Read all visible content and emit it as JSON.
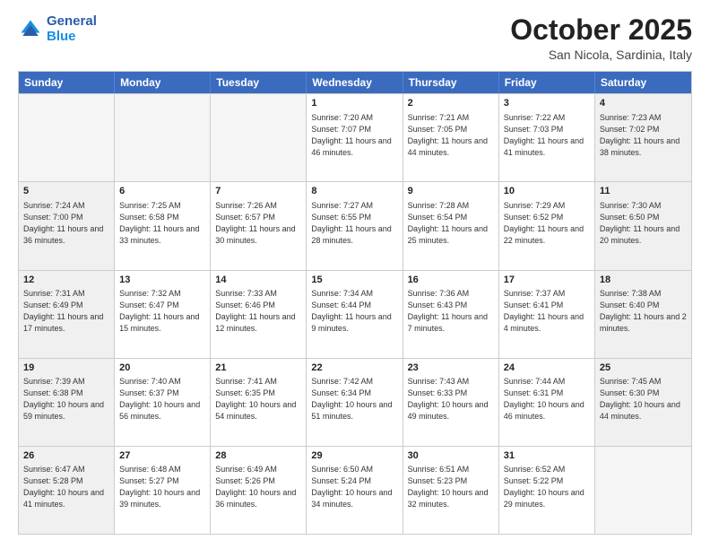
{
  "header": {
    "logo_line1": "General",
    "logo_line2": "Blue",
    "month_title": "October 2025",
    "location": "San Nicola, Sardinia, Italy"
  },
  "weekdays": [
    "Sunday",
    "Monday",
    "Tuesday",
    "Wednesday",
    "Thursday",
    "Friday",
    "Saturday"
  ],
  "rows": [
    [
      {
        "day": "",
        "info": "",
        "empty": true
      },
      {
        "day": "",
        "info": "",
        "empty": true
      },
      {
        "day": "",
        "info": "",
        "empty": true
      },
      {
        "day": "1",
        "info": "Sunrise: 7:20 AM\nSunset: 7:07 PM\nDaylight: 11 hours\nand 46 minutes.",
        "empty": false
      },
      {
        "day": "2",
        "info": "Sunrise: 7:21 AM\nSunset: 7:05 PM\nDaylight: 11 hours\nand 44 minutes.",
        "empty": false
      },
      {
        "day": "3",
        "info": "Sunrise: 7:22 AM\nSunset: 7:03 PM\nDaylight: 11 hours\nand 41 minutes.",
        "empty": false
      },
      {
        "day": "4",
        "info": "Sunrise: 7:23 AM\nSunset: 7:02 PM\nDaylight: 11 hours\nand 38 minutes.",
        "empty": false,
        "shaded": true
      }
    ],
    [
      {
        "day": "5",
        "info": "Sunrise: 7:24 AM\nSunset: 7:00 PM\nDaylight: 11 hours\nand 36 minutes.",
        "empty": false,
        "shaded": true
      },
      {
        "day": "6",
        "info": "Sunrise: 7:25 AM\nSunset: 6:58 PM\nDaylight: 11 hours\nand 33 minutes.",
        "empty": false
      },
      {
        "day": "7",
        "info": "Sunrise: 7:26 AM\nSunset: 6:57 PM\nDaylight: 11 hours\nand 30 minutes.",
        "empty": false
      },
      {
        "day": "8",
        "info": "Sunrise: 7:27 AM\nSunset: 6:55 PM\nDaylight: 11 hours\nand 28 minutes.",
        "empty": false
      },
      {
        "day": "9",
        "info": "Sunrise: 7:28 AM\nSunset: 6:54 PM\nDaylight: 11 hours\nand 25 minutes.",
        "empty": false
      },
      {
        "day": "10",
        "info": "Sunrise: 7:29 AM\nSunset: 6:52 PM\nDaylight: 11 hours\nand 22 minutes.",
        "empty": false
      },
      {
        "day": "11",
        "info": "Sunrise: 7:30 AM\nSunset: 6:50 PM\nDaylight: 11 hours\nand 20 minutes.",
        "empty": false,
        "shaded": true
      }
    ],
    [
      {
        "day": "12",
        "info": "Sunrise: 7:31 AM\nSunset: 6:49 PM\nDaylight: 11 hours\nand 17 minutes.",
        "empty": false,
        "shaded": true
      },
      {
        "day": "13",
        "info": "Sunrise: 7:32 AM\nSunset: 6:47 PM\nDaylight: 11 hours\nand 15 minutes.",
        "empty": false
      },
      {
        "day": "14",
        "info": "Sunrise: 7:33 AM\nSunset: 6:46 PM\nDaylight: 11 hours\nand 12 minutes.",
        "empty": false
      },
      {
        "day": "15",
        "info": "Sunrise: 7:34 AM\nSunset: 6:44 PM\nDaylight: 11 hours\nand 9 minutes.",
        "empty": false
      },
      {
        "day": "16",
        "info": "Sunrise: 7:36 AM\nSunset: 6:43 PM\nDaylight: 11 hours\nand 7 minutes.",
        "empty": false
      },
      {
        "day": "17",
        "info": "Sunrise: 7:37 AM\nSunset: 6:41 PM\nDaylight: 11 hours\nand 4 minutes.",
        "empty": false
      },
      {
        "day": "18",
        "info": "Sunrise: 7:38 AM\nSunset: 6:40 PM\nDaylight: 11 hours\nand 2 minutes.",
        "empty": false,
        "shaded": true
      }
    ],
    [
      {
        "day": "19",
        "info": "Sunrise: 7:39 AM\nSunset: 6:38 PM\nDaylight: 10 hours\nand 59 minutes.",
        "empty": false,
        "shaded": true
      },
      {
        "day": "20",
        "info": "Sunrise: 7:40 AM\nSunset: 6:37 PM\nDaylight: 10 hours\nand 56 minutes.",
        "empty": false
      },
      {
        "day": "21",
        "info": "Sunrise: 7:41 AM\nSunset: 6:35 PM\nDaylight: 10 hours\nand 54 minutes.",
        "empty": false
      },
      {
        "day": "22",
        "info": "Sunrise: 7:42 AM\nSunset: 6:34 PM\nDaylight: 10 hours\nand 51 minutes.",
        "empty": false
      },
      {
        "day": "23",
        "info": "Sunrise: 7:43 AM\nSunset: 6:33 PM\nDaylight: 10 hours\nand 49 minutes.",
        "empty": false
      },
      {
        "day": "24",
        "info": "Sunrise: 7:44 AM\nSunset: 6:31 PM\nDaylight: 10 hours\nand 46 minutes.",
        "empty": false
      },
      {
        "day": "25",
        "info": "Sunrise: 7:45 AM\nSunset: 6:30 PM\nDaylight: 10 hours\nand 44 minutes.",
        "empty": false,
        "shaded": true
      }
    ],
    [
      {
        "day": "26",
        "info": "Sunrise: 6:47 AM\nSunset: 5:28 PM\nDaylight: 10 hours\nand 41 minutes.",
        "empty": false,
        "shaded": true
      },
      {
        "day": "27",
        "info": "Sunrise: 6:48 AM\nSunset: 5:27 PM\nDaylight: 10 hours\nand 39 minutes.",
        "empty": false
      },
      {
        "day": "28",
        "info": "Sunrise: 6:49 AM\nSunset: 5:26 PM\nDaylight: 10 hours\nand 36 minutes.",
        "empty": false
      },
      {
        "day": "29",
        "info": "Sunrise: 6:50 AM\nSunset: 5:24 PM\nDaylight: 10 hours\nand 34 minutes.",
        "empty": false
      },
      {
        "day": "30",
        "info": "Sunrise: 6:51 AM\nSunset: 5:23 PM\nDaylight: 10 hours\nand 32 minutes.",
        "empty": false
      },
      {
        "day": "31",
        "info": "Sunrise: 6:52 AM\nSunset: 5:22 PM\nDaylight: 10 hours\nand 29 minutes.",
        "empty": false
      },
      {
        "day": "",
        "info": "",
        "empty": true,
        "shaded": true
      }
    ]
  ]
}
